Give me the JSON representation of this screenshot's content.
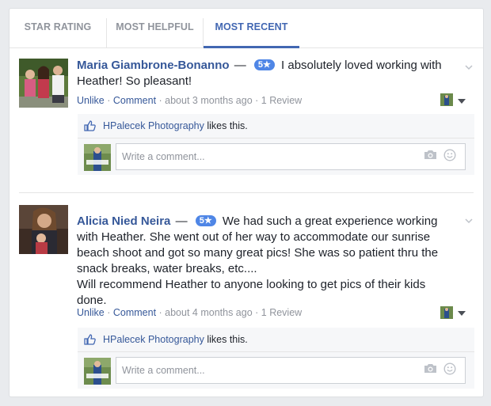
{
  "tabs": [
    {
      "label": "STAR RATING",
      "active": false
    },
    {
      "label": "MOST HELPFUL",
      "active": false
    },
    {
      "label": "MOST RECENT",
      "active": true
    }
  ],
  "reviews": [
    {
      "name": "Maria Giambrone-Bonanno",
      "dash": "—",
      "rating": "5★",
      "text": "I absolutely loved working with Heather! So pleasant!",
      "unlike": "Unlike",
      "comment": "Comment",
      "time": "about 3 months ago",
      "review_count": "1 Review",
      "liked_by": "HPalecek Photography",
      "likes_suffix": "likes this.",
      "comment_placeholder": "Write a comment..."
    },
    {
      "name": "Alicia Nied Neira",
      "dash": "—",
      "rating": "5★",
      "text": "We had such a great experience working with Heather. She went out of her way to accommodate our sunrise beach shoot and got so many great pics! She was so patient thru the snack breaks, water breaks, etc....",
      "text2": "Will recommend Heather to anyone looking to get pics of their kids done.",
      "unlike": "Unlike",
      "comment": "Comment",
      "time": "about 4 months ago",
      "review_count": "1 Review",
      "liked_by": "HPalecek Photography",
      "likes_suffix": "likes this.",
      "comment_placeholder": "Write a comment..."
    }
  ],
  "colors": {
    "accent": "#4267b2",
    "link": "#365899",
    "badge": "#4f86e6",
    "muted": "#90949c"
  },
  "icons": [
    "chevron-down-icon",
    "thumbs-up-icon",
    "camera-icon",
    "smiley-icon",
    "dropdown-arrow-icon"
  ]
}
